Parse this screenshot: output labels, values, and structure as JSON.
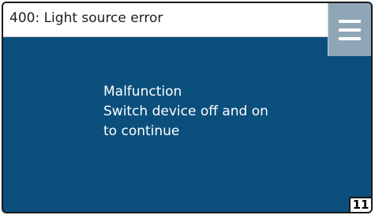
{
  "header": {
    "title": "400: Light source error"
  },
  "menu": {
    "icon": "hamburger-menu-icon"
  },
  "message": {
    "lines": [
      "Malfunction",
      "Switch device off and on",
      "to continue"
    ]
  },
  "page_number": "11",
  "colors": {
    "background": "#0b4f7c",
    "menu_button": "#8fa6b7",
    "title_bar": "#ffffff"
  }
}
